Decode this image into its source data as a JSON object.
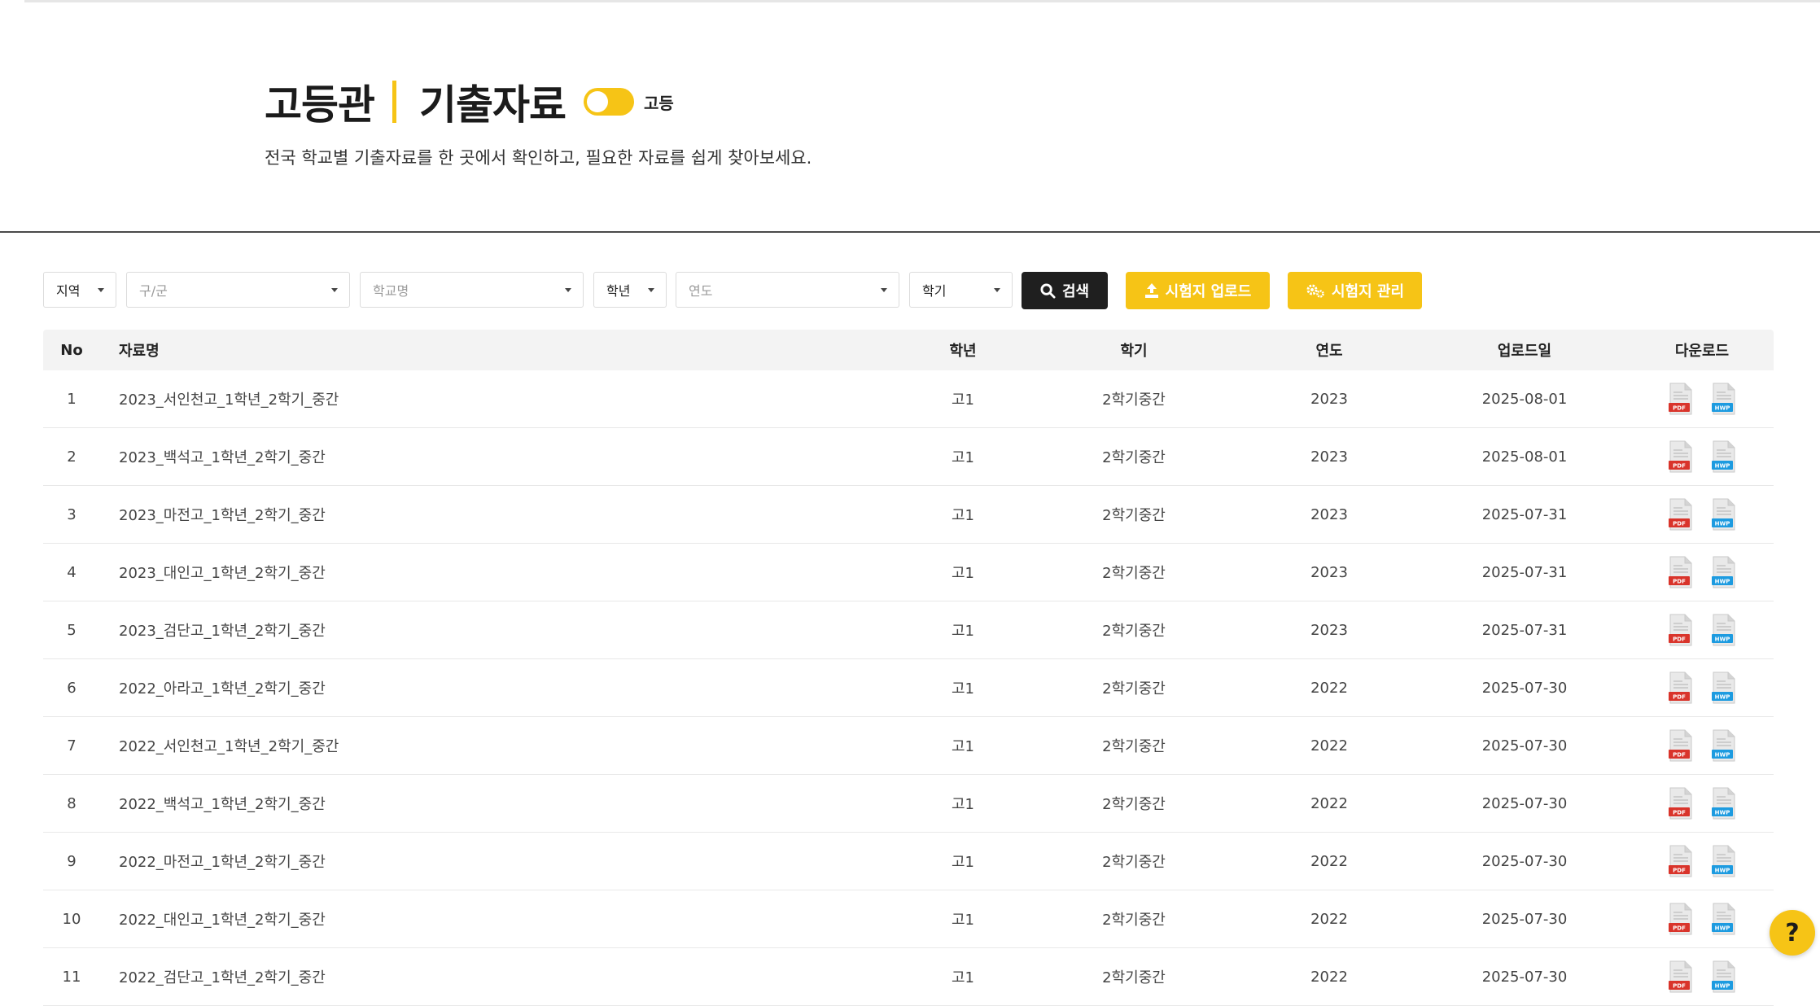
{
  "header": {
    "title_main": "고등관",
    "title_sub": "기출자료",
    "toggle_label": "고등",
    "subtitle": "전국 학교별 기출자료를 한 곳에서 확인하고, 필요한 자료를 쉽게 찾아보세요."
  },
  "filters": {
    "region": "지역",
    "district": "구/군",
    "school": "학교명",
    "grade": "학년",
    "year": "연도",
    "semester": "학기",
    "search_label": "검색",
    "upload_label": "시험지 업로드",
    "manage_label": "시험지 관리"
  },
  "table": {
    "headers": {
      "no": "No",
      "name": "자료명",
      "grade": "학년",
      "semester": "학기",
      "year": "연도",
      "date": "업로드일",
      "download": "다운로드"
    },
    "rows": [
      {
        "no": "1",
        "name": "2023_서인천고_1학년_2학기_중간",
        "grade": "고1",
        "semester": "2학기중간",
        "year": "2023",
        "date": "2025-08-01"
      },
      {
        "no": "2",
        "name": "2023_백석고_1학년_2학기_중간",
        "grade": "고1",
        "semester": "2학기중간",
        "year": "2023",
        "date": "2025-08-01"
      },
      {
        "no": "3",
        "name": "2023_마전고_1학년_2학기_중간",
        "grade": "고1",
        "semester": "2학기중간",
        "year": "2023",
        "date": "2025-07-31"
      },
      {
        "no": "4",
        "name": "2023_대인고_1학년_2학기_중간",
        "grade": "고1",
        "semester": "2학기중간",
        "year": "2023",
        "date": "2025-07-31"
      },
      {
        "no": "5",
        "name": "2023_검단고_1학년_2학기_중간",
        "grade": "고1",
        "semester": "2학기중간",
        "year": "2023",
        "date": "2025-07-31"
      },
      {
        "no": "6",
        "name": "2022_아라고_1학년_2학기_중간",
        "grade": "고1",
        "semester": "2학기중간",
        "year": "2022",
        "date": "2025-07-30"
      },
      {
        "no": "7",
        "name": "2022_서인천고_1학년_2학기_중간",
        "grade": "고1",
        "semester": "2학기중간",
        "year": "2022",
        "date": "2025-07-30"
      },
      {
        "no": "8",
        "name": "2022_백석고_1학년_2학기_중간",
        "grade": "고1",
        "semester": "2학기중간",
        "year": "2022",
        "date": "2025-07-30"
      },
      {
        "no": "9",
        "name": "2022_마전고_1학년_2학기_중간",
        "grade": "고1",
        "semester": "2학기중간",
        "year": "2022",
        "date": "2025-07-30"
      },
      {
        "no": "10",
        "name": "2022_대인고_1학년_2학기_중간",
        "grade": "고1",
        "semester": "2학기중간",
        "year": "2022",
        "date": "2025-07-30"
      },
      {
        "no": "11",
        "name": "2022_검단고_1학년_2학기_중간",
        "grade": "고1",
        "semester": "2학기중간",
        "year": "2022",
        "date": "2025-07-30"
      }
    ]
  },
  "icons": {
    "pdf_badge": "PDF",
    "hwp_badge": "HWP",
    "pdf_icon": "pdf-file-icon",
    "hwp_icon": "hwp-file-icon"
  },
  "help": {
    "label": "?"
  },
  "colors": {
    "accent": "#f6c416",
    "dark": "#1f1f1f",
    "pdf": "#d9342b",
    "hwp": "#1d9be0"
  }
}
